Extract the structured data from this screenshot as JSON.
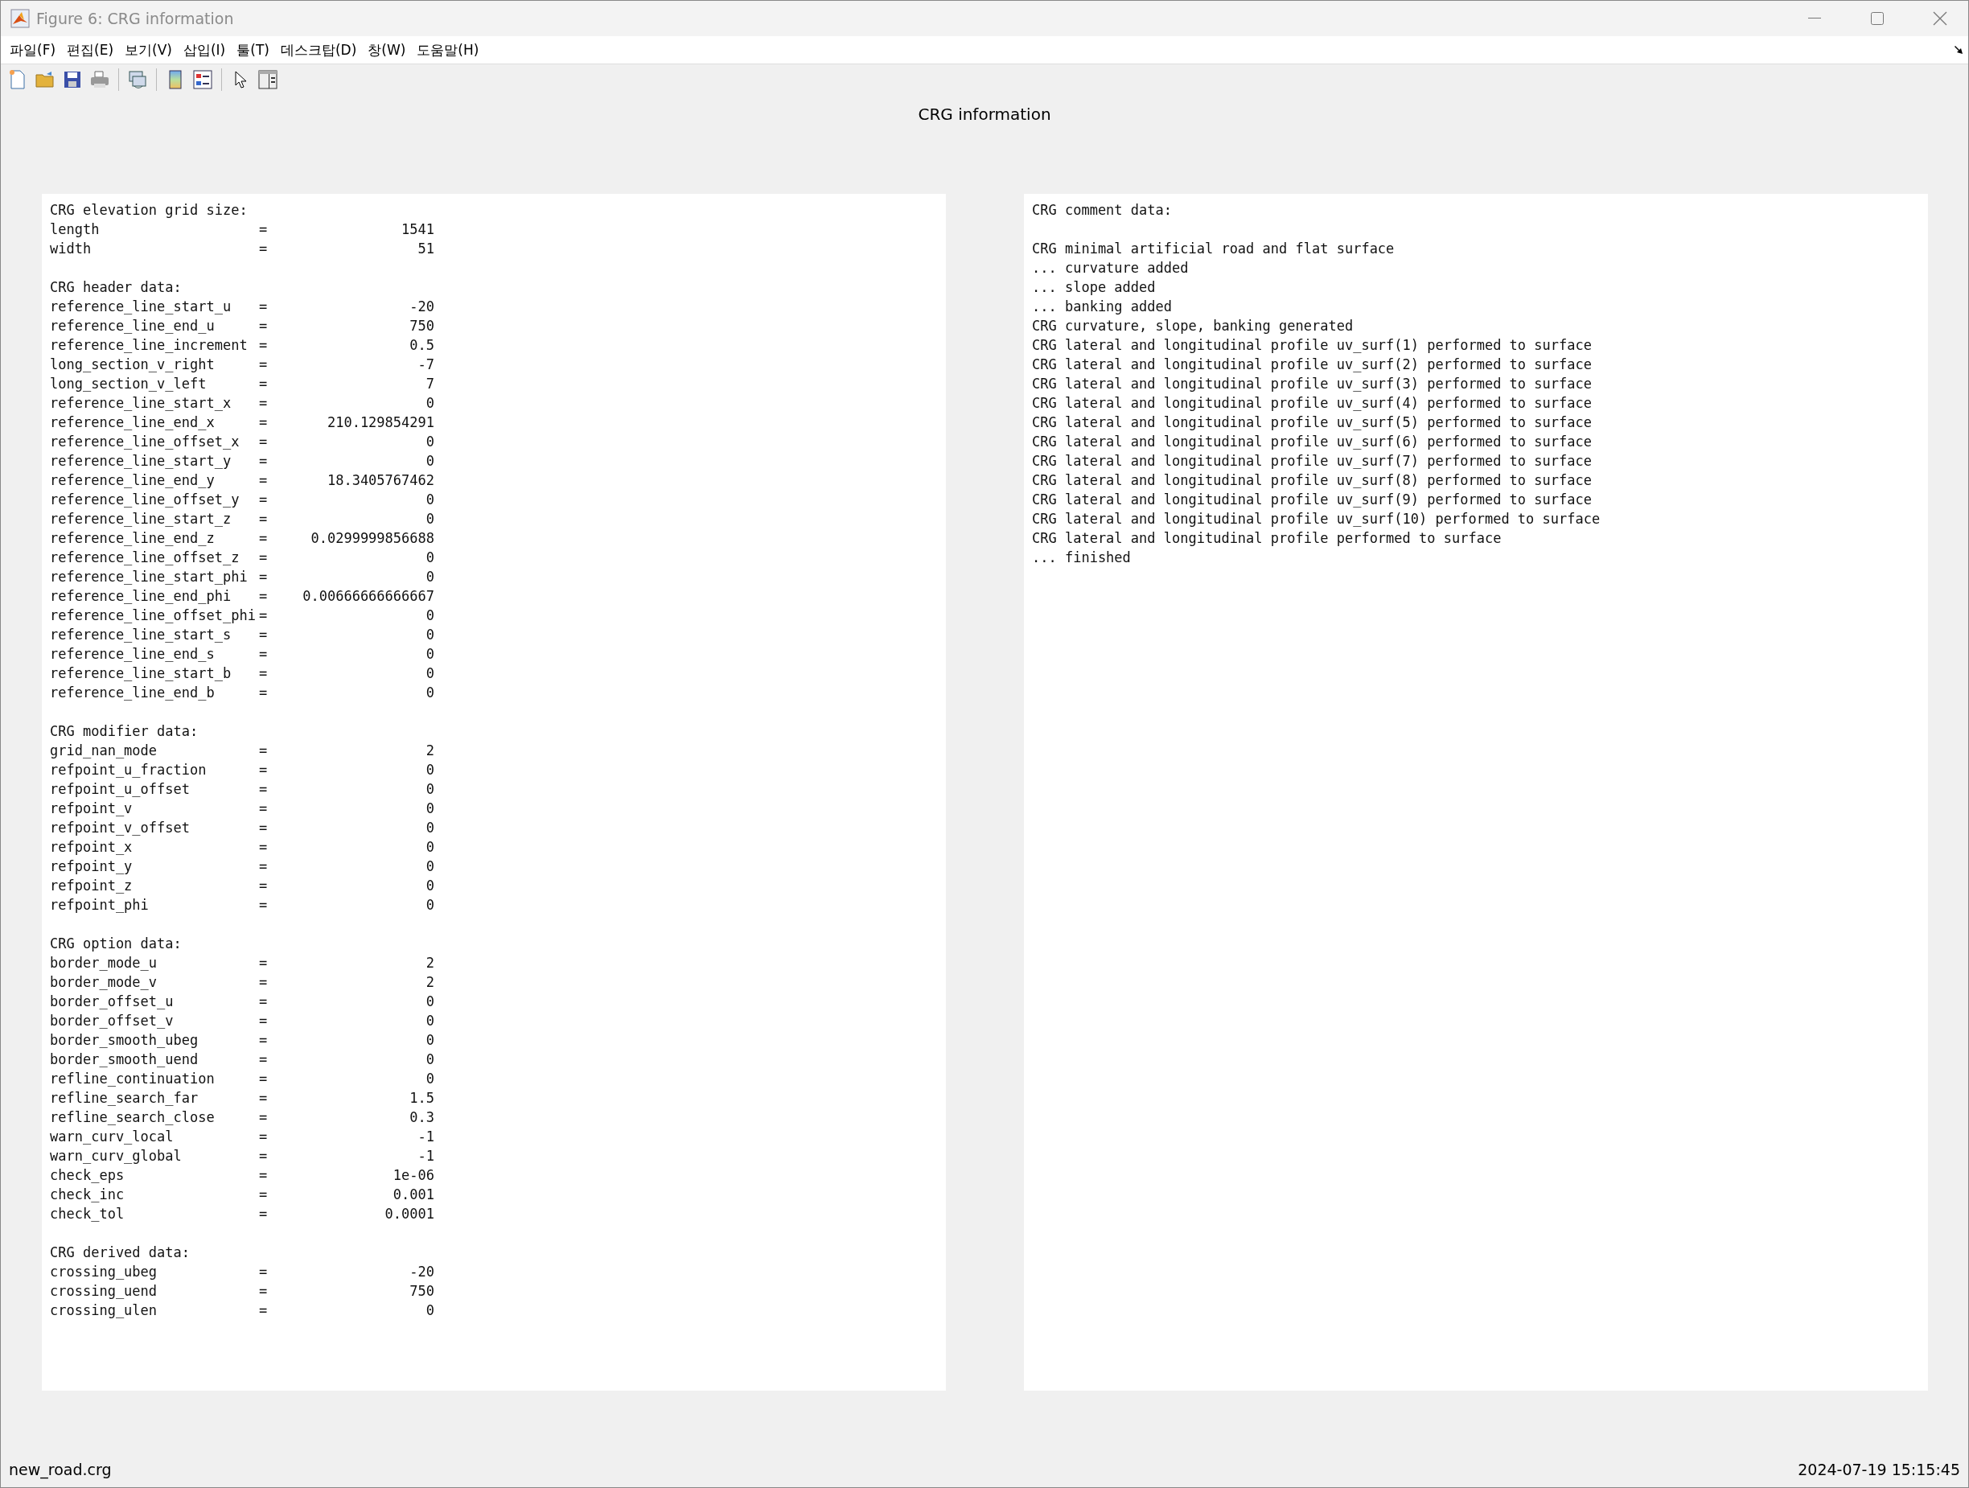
{
  "window": {
    "title": "Figure 6: CRG information"
  },
  "menu": [
    "파일(F)",
    "편집(E)",
    "보기(V)",
    "삽입(I)",
    "툴(T)",
    "데스크탑(D)",
    "창(W)",
    "도움말(H)"
  ],
  "figure_title": "CRG information",
  "left_panel": {
    "sections": [
      {
        "heading": "CRG elevation grid size:",
        "rows": [
          {
            "label": "length",
            "sep": "=",
            "value": "1541"
          },
          {
            "label": "width",
            "sep": "=",
            "value": "51"
          }
        ]
      },
      {
        "heading": "CRG header data:",
        "rows": [
          {
            "label": "reference_line_start_u",
            "sep": "=",
            "value": "-20"
          },
          {
            "label": "reference_line_end_u",
            "sep": "=",
            "value": "750"
          },
          {
            "label": "reference_line_increment",
            "sep": "=",
            "value": "0.5"
          },
          {
            "label": "long_section_v_right",
            "sep": "=",
            "value": "-7"
          },
          {
            "label": "long_section_v_left",
            "sep": "=",
            "value": "7"
          },
          {
            "label": "reference_line_start_x",
            "sep": "=",
            "value": "0"
          },
          {
            "label": "reference_line_end_x",
            "sep": "=",
            "value": "210.129854291"
          },
          {
            "label": "reference_line_offset_x",
            "sep": "=",
            "value": "0"
          },
          {
            "label": "reference_line_start_y",
            "sep": "=",
            "value": "0"
          },
          {
            "label": "reference_line_end_y",
            "sep": "=",
            "value": "18.3405767462"
          },
          {
            "label": "reference_line_offset_y",
            "sep": "=",
            "value": "0"
          },
          {
            "label": "reference_line_start_z",
            "sep": "=",
            "value": "0"
          },
          {
            "label": "reference_line_end_z",
            "sep": "=",
            "value": "0.0299999856688"
          },
          {
            "label": "reference_line_offset_z",
            "sep": "=",
            "value": "0"
          },
          {
            "label": "reference_line_start_phi",
            "sep": "=",
            "value": "0"
          },
          {
            "label": "reference_line_end_phi",
            "sep": "=",
            "value": "0.00666666666667"
          },
          {
            "label": "reference_line_offset_phi",
            "sep": "=",
            "value": "0"
          },
          {
            "label": "reference_line_start_s",
            "sep": "=",
            "value": "0"
          },
          {
            "label": "reference_line_end_s",
            "sep": "=",
            "value": "0"
          },
          {
            "label": "reference_line_start_b",
            "sep": "=",
            "value": "0"
          },
          {
            "label": "reference_line_end_b",
            "sep": "=",
            "value": "0"
          }
        ]
      },
      {
        "heading": "CRG modifier data:",
        "rows": [
          {
            "label": "grid_nan_mode",
            "sep": "=",
            "value": "2"
          },
          {
            "label": "refpoint_u_fraction",
            "sep": "=",
            "value": "0"
          },
          {
            "label": "refpoint_u_offset",
            "sep": "=",
            "value": "0"
          },
          {
            "label": "refpoint_v",
            "sep": "=",
            "value": "0"
          },
          {
            "label": "refpoint_v_offset",
            "sep": "=",
            "value": "0"
          },
          {
            "label": "refpoint_x",
            "sep": "=",
            "value": "0"
          },
          {
            "label": "refpoint_y",
            "sep": "=",
            "value": "0"
          },
          {
            "label": "refpoint_z",
            "sep": "=",
            "value": "0"
          },
          {
            "label": "refpoint_phi",
            "sep": "=",
            "value": "0"
          }
        ]
      },
      {
        "heading": "CRG option data:",
        "rows": [
          {
            "label": "border_mode_u",
            "sep": "=",
            "value": "2"
          },
          {
            "label": "border_mode_v",
            "sep": "=",
            "value": "2"
          },
          {
            "label": "border_offset_u",
            "sep": "=",
            "value": "0"
          },
          {
            "label": "border_offset_v",
            "sep": "=",
            "value": "0"
          },
          {
            "label": "border_smooth_ubeg",
            "sep": "=",
            "value": "0"
          },
          {
            "label": "border_smooth_uend",
            "sep": "=",
            "value": "0"
          },
          {
            "label": "refline_continuation",
            "sep": "=",
            "value": "0"
          },
          {
            "label": "refline_search_far",
            "sep": "=",
            "value": "1.5"
          },
          {
            "label": "refline_search_close",
            "sep": "=",
            "value": "0.3"
          },
          {
            "label": "warn_curv_local",
            "sep": "=",
            "value": "-1"
          },
          {
            "label": "warn_curv_global",
            "sep": "=",
            "value": "-1"
          },
          {
            "label": "check_eps",
            "sep": "=",
            "value": "1e-06"
          },
          {
            "label": "check_inc",
            "sep": "=",
            "value": "0.001"
          },
          {
            "label": "check_tol",
            "sep": "=",
            "value": "0.0001"
          }
        ]
      },
      {
        "heading": "CRG derived data:",
        "rows": [
          {
            "label": "crossing_ubeg",
            "sep": "=",
            "value": "-20"
          },
          {
            "label": "crossing_uend",
            "sep": "=",
            "value": "750"
          },
          {
            "label": "crossing_ulen",
            "sep": "=",
            "value": "0"
          }
        ]
      }
    ]
  },
  "right_panel": {
    "heading": "CRG comment data:",
    "lines": [
      "CRG minimal artificial road and flat surface",
      "... curvature added",
      "... slope added",
      "... banking added",
      "CRG curvature, slope, banking generated",
      "CRG lateral and longitudinal profile uv_surf(1) performed to surface",
      "CRG lateral and longitudinal profile uv_surf(2) performed to surface",
      "CRG lateral and longitudinal profile uv_surf(3) performed to surface",
      "CRG lateral and longitudinal profile uv_surf(4) performed to surface",
      "CRG lateral and longitudinal profile uv_surf(5) performed to surface",
      "CRG lateral and longitudinal profile uv_surf(6) performed to surface",
      "CRG lateral and longitudinal profile uv_surf(7) performed to surface",
      "CRG lateral and longitudinal profile uv_surf(8) performed to surface",
      "CRG lateral and longitudinal profile uv_surf(9) performed to surface",
      "CRG lateral and longitudinal profile uv_surf(10) performed to surface",
      "CRG lateral and longitudinal profile performed to surface",
      "... finished"
    ]
  },
  "status_bar": {
    "filename": "new_road.crg",
    "timestamp": "2024-07-19 15:15:45"
  }
}
